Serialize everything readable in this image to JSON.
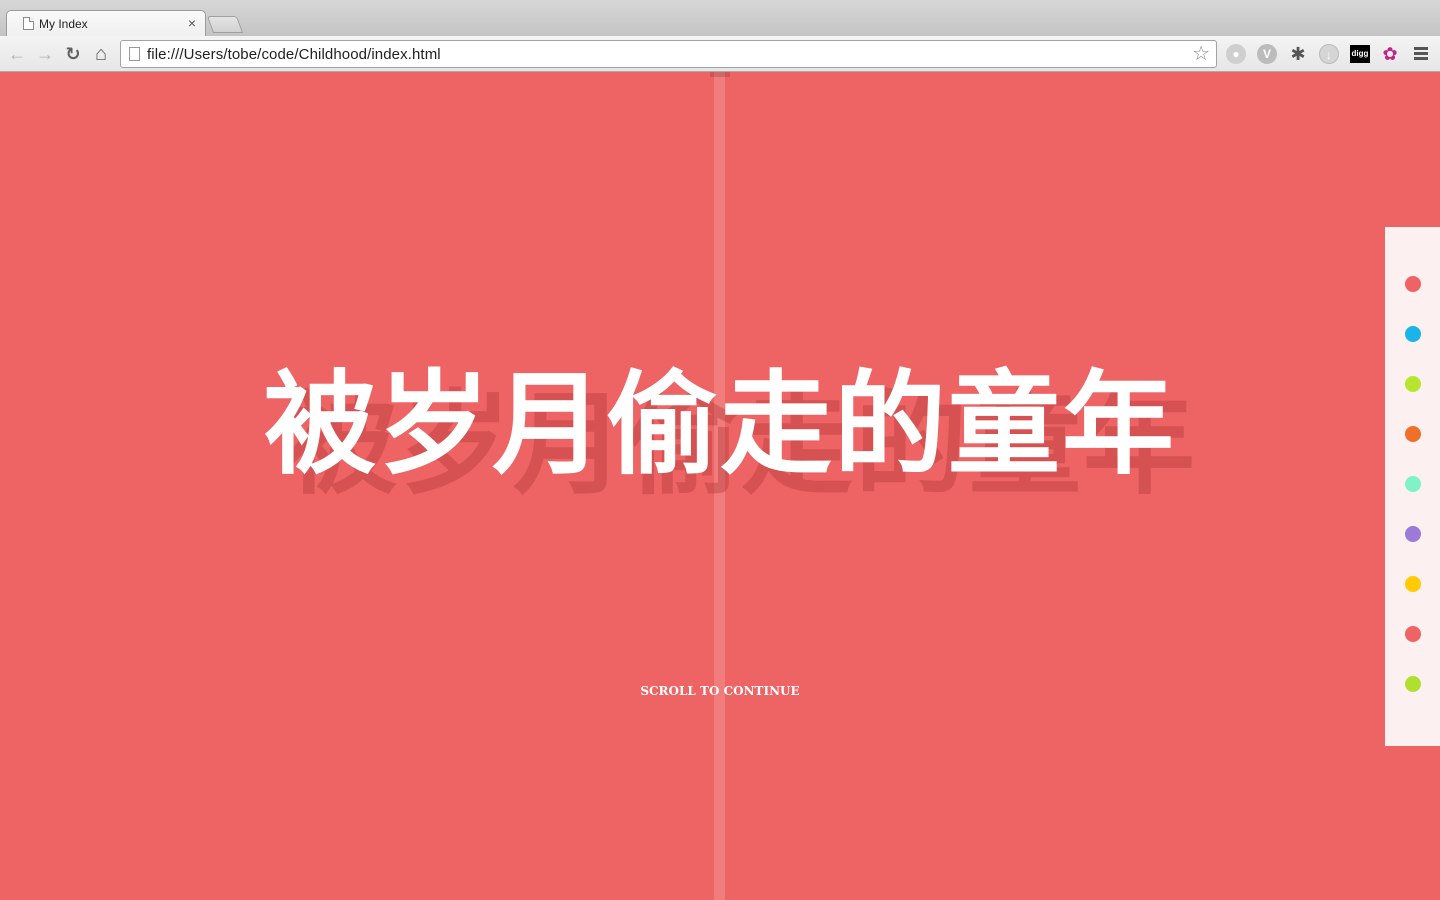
{
  "browser": {
    "tab_title": "My Index",
    "tab_close": "×",
    "url": "file:///Users/tobe/code/Childhood/index.html",
    "nav": {
      "back": "←",
      "forward": "→",
      "reload": "↻",
      "home": "⌂"
    },
    "bookmark_star": "☆",
    "extensions": {
      "globe": "●",
      "v": "V",
      "bug": "✱",
      "download": "↓",
      "digg": "digg",
      "flower": "✿"
    }
  },
  "page": {
    "title": "被岁月偷走的童年",
    "scroll_hint": "SCROLL TO CONTINUE"
  },
  "dot_nav": {
    "dots": [
      {
        "color": "#ee6363"
      },
      {
        "color": "#19b5ea"
      },
      {
        "color": "#b7e42f"
      },
      {
        "color": "#ef7028"
      },
      {
        "color": "#7ff2c7"
      },
      {
        "color": "#9b7ad8"
      },
      {
        "color": "#ffcb05"
      },
      {
        "color": "#ee6363"
      },
      {
        "color": "#b0e02f"
      }
    ]
  }
}
